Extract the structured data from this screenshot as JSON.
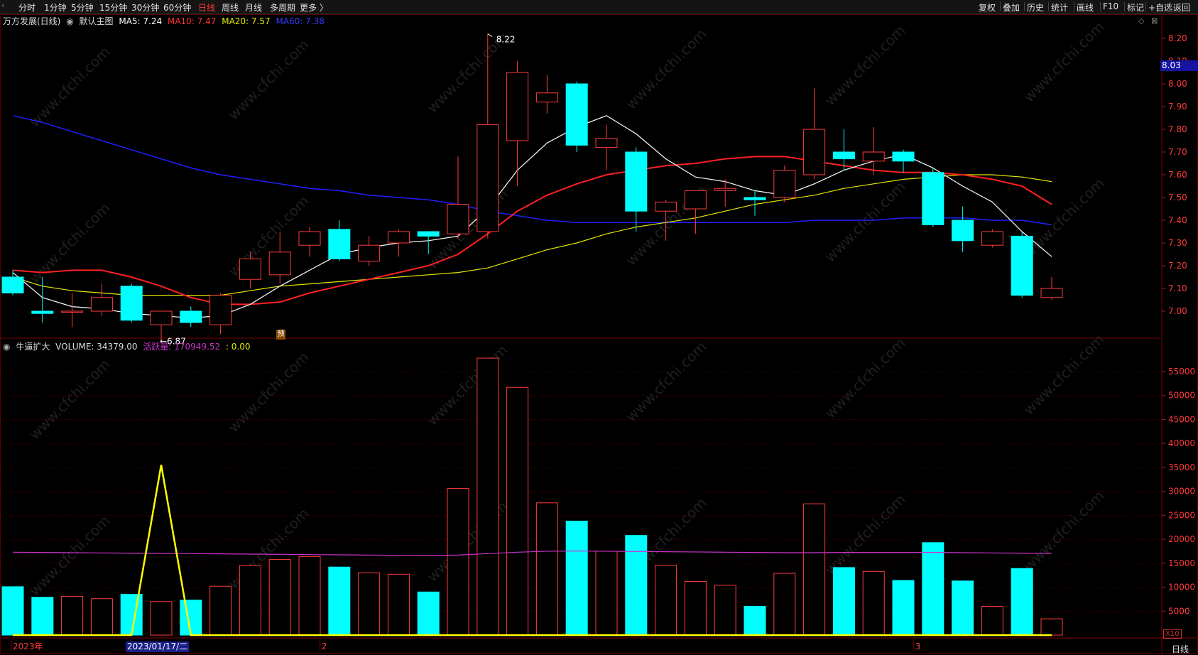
{
  "toolbar": {
    "left_tabs": [
      "分时",
      "1分钟",
      "5分钟",
      "15分钟",
      "30分钟",
      "60分钟",
      "日线",
      "周线",
      "月线",
      "多周期",
      "更多 〉"
    ],
    "active_tab": "日线",
    "right_tabs": [
      "复权",
      "叠加",
      "历史",
      "统计",
      "画线",
      "F10",
      "标记",
      "+自选",
      "返回"
    ]
  },
  "main_header": {
    "stock": "万方发展(日线)",
    "template": "默认主图",
    "ma5": "MA5: 7.24",
    "ma10": "MA10: 7.47",
    "ma20": "MA20: 7.57",
    "ma60": "MA60: 7.38"
  },
  "vol_header": {
    "indicator": "牛逼扩大",
    "volume": "VOLUME: 34379.00",
    "active": "活跃量: 170949.52",
    "extra": ": 0.00"
  },
  "colors": {
    "up": "#ff3b3b",
    "down": "#00ffff",
    "ma5": "#ffffff",
    "ma10": "#ff2020",
    "ma20": "#e6e600",
    "ma60": "#2020ff",
    "active_line": "#cc33cc",
    "signal_line": "#ffff00",
    "grid": "#5a0000"
  },
  "annotations": {
    "high": "8.22",
    "low": "6.87",
    "yu": "预",
    "last_price": "8.03",
    "selected_date": "2023/01/17/二",
    "x10": "X10",
    "period": "日线"
  },
  "chart_data": {
    "type": "candlestick",
    "price_ylim": [
      6.9,
      8.25
    ],
    "price_ticks": [
      "8.20",
      "8.10",
      "8.00",
      "7.90",
      "7.80",
      "7.70",
      "7.60",
      "7.50",
      "7.40",
      "7.30",
      "7.20",
      "7.10",
      "7.00"
    ],
    "volume_ylim": [
      0,
      59000
    ],
    "volume_ticks": [
      "55000",
      "50000",
      "45000",
      "40000",
      "35000",
      "30000",
      "25000",
      "20000",
      "15000",
      "10000",
      "5000"
    ],
    "x_labels": [
      {
        "index": 0,
        "label": "2023年"
      },
      {
        "index": 10.4,
        "label": "2"
      },
      {
        "index": 30.4,
        "label": "3"
      }
    ],
    "candles": [
      {
        "o": 7.15,
        "h": 7.18,
        "l": 7.07,
        "c": 7.08,
        "v": 10100
      },
      {
        "o": 7.0,
        "h": 7.15,
        "l": 6.95,
        "c": 6.99,
        "v": 7900
      },
      {
        "o": 7.0,
        "h": 7.08,
        "l": 6.93,
        "c": 7.0,
        "v": 8100
      },
      {
        "o": 7.0,
        "h": 7.12,
        "l": 6.98,
        "c": 7.06,
        "v": 7600
      },
      {
        "o": 7.11,
        "h": 7.12,
        "l": 6.95,
        "c": 6.96,
        "v": 8500
      },
      {
        "o": 6.94,
        "h": 7.0,
        "l": 6.87,
        "c": 7.0,
        "v": 7000
      },
      {
        "o": 7.0,
        "h": 7.02,
        "l": 6.93,
        "c": 6.95,
        "v": 7300
      },
      {
        "o": 6.94,
        "h": 7.08,
        "l": 6.9,
        "c": 7.07,
        "v": 10200
      },
      {
        "o": 7.14,
        "h": 7.26,
        "l": 7.1,
        "c": 7.23,
        "v": 14500
      },
      {
        "o": 7.16,
        "h": 7.35,
        "l": 7.12,
        "c": 7.26,
        "v": 15800
      },
      {
        "o": 7.29,
        "h": 7.37,
        "l": 7.24,
        "c": 7.35,
        "v": 16400
      },
      {
        "o": 7.36,
        "h": 7.4,
        "l": 7.22,
        "c": 7.23,
        "v": 14200
      },
      {
        "o": 7.22,
        "h": 7.33,
        "l": 7.2,
        "c": 7.29,
        "v": 13000
      },
      {
        "o": 7.3,
        "h": 7.36,
        "l": 7.24,
        "c": 7.35,
        "v": 12700
      },
      {
        "o": 7.35,
        "h": 7.35,
        "l": 7.25,
        "c": 7.33,
        "v": 9000
      },
      {
        "o": 7.34,
        "h": 7.68,
        "l": 7.32,
        "c": 7.47,
        "v": 30600
      },
      {
        "o": 7.35,
        "h": 8.22,
        "l": 7.32,
        "c": 7.82,
        "v": 57800
      },
      {
        "o": 7.75,
        "h": 8.1,
        "l": 7.55,
        "c": 8.05,
        "v": 51700
      },
      {
        "o": 7.92,
        "h": 8.04,
        "l": 7.87,
        "c": 7.96,
        "v": 27600
      },
      {
        "o": 8.0,
        "h": 8.01,
        "l": 7.7,
        "c": 7.73,
        "v": 23800
      },
      {
        "o": 7.72,
        "h": 7.82,
        "l": 7.62,
        "c": 7.76,
        "v": 17500
      },
      {
        "o": 7.7,
        "h": 7.72,
        "l": 7.35,
        "c": 7.44,
        "v": 20800
      },
      {
        "o": 7.44,
        "h": 7.49,
        "l": 7.31,
        "c": 7.48,
        "v": 14600
      },
      {
        "o": 7.45,
        "h": 7.53,
        "l": 7.34,
        "c": 7.53,
        "v": 11200
      },
      {
        "o": 7.53,
        "h": 7.58,
        "l": 7.46,
        "c": 7.54,
        "v": 10400
      },
      {
        "o": 7.5,
        "h": 7.53,
        "l": 7.42,
        "c": 7.49,
        "v": 6000
      },
      {
        "o": 7.5,
        "h": 7.64,
        "l": 7.48,
        "c": 7.62,
        "v": 12900
      },
      {
        "o": 7.6,
        "h": 7.98,
        "l": 7.58,
        "c": 7.8,
        "v": 27400
      },
      {
        "o": 7.7,
        "h": 7.8,
        "l": 7.62,
        "c": 7.67,
        "v": 14100
      },
      {
        "o": 7.66,
        "h": 7.81,
        "l": 7.6,
        "c": 7.7,
        "v": 13300
      },
      {
        "o": 7.7,
        "h": 7.71,
        "l": 7.61,
        "c": 7.66,
        "v": 11400
      },
      {
        "o": 7.61,
        "h": 7.63,
        "l": 7.37,
        "c": 7.38,
        "v": 19300
      },
      {
        "o": 7.4,
        "h": 7.46,
        "l": 7.26,
        "c": 7.31,
        "v": 11300
      },
      {
        "o": 7.29,
        "h": 7.36,
        "l": 7.28,
        "c": 7.35,
        "v": 6000
      },
      {
        "o": 7.33,
        "h": 7.35,
        "l": 7.06,
        "c": 7.07,
        "v": 13900
      },
      {
        "o": 7.06,
        "h": 7.15,
        "l": 7.05,
        "c": 7.1,
        "v": 3400
      }
    ],
    "ma5": [
      7.17,
      7.06,
      7.02,
      7.01,
      6.99,
      6.98,
      6.97,
      6.98,
      7.03,
      7.11,
      7.18,
      7.25,
      7.28,
      7.3,
      7.31,
      7.33,
      7.45,
      7.62,
      7.74,
      7.81,
      7.86,
      7.78,
      7.67,
      7.59,
      7.57,
      7.53,
      7.51,
      7.56,
      7.62,
      7.66,
      7.69,
      7.63,
      7.55,
      7.48,
      7.35,
      7.24
    ],
    "ma10": [
      7.18,
      7.17,
      7.18,
      7.18,
      7.15,
      7.11,
      7.06,
      7.03,
      7.03,
      7.04,
      7.08,
      7.11,
      7.14,
      7.17,
      7.2,
      7.25,
      7.34,
      7.44,
      7.51,
      7.56,
      7.6,
      7.62,
      7.64,
      7.65,
      7.67,
      7.68,
      7.68,
      7.66,
      7.64,
      7.62,
      7.61,
      7.61,
      7.6,
      7.58,
      7.55,
      7.47
    ],
    "ma20": [
      7.15,
      7.11,
      7.09,
      7.08,
      7.07,
      7.07,
      7.07,
      7.07,
      7.09,
      7.11,
      7.12,
      7.13,
      7.14,
      7.15,
      7.16,
      7.17,
      7.19,
      7.23,
      7.27,
      7.3,
      7.34,
      7.37,
      7.39,
      7.41,
      7.44,
      7.47,
      7.49,
      7.51,
      7.54,
      7.56,
      7.58,
      7.59,
      7.6,
      7.6,
      7.59,
      7.57
    ],
    "ma60": [
      7.86,
      7.83,
      7.79,
      7.75,
      7.71,
      7.67,
      7.63,
      7.6,
      7.58,
      7.56,
      7.54,
      7.53,
      7.51,
      7.5,
      7.49,
      7.47,
      7.44,
      7.42,
      7.4,
      7.39,
      7.39,
      7.39,
      7.39,
      7.39,
      7.39,
      7.39,
      7.39,
      7.4,
      7.4,
      7.4,
      7.41,
      7.41,
      7.41,
      7.4,
      7.4,
      7.38
    ],
    "active_line": [
      17300,
      17250,
      17200,
      17150,
      17100,
      17050,
      17000,
      16950,
      16900,
      16850,
      16800,
      16750,
      16700,
      16650,
      16600,
      16700,
      17000,
      17300,
      17500,
      17550,
      17500,
      17450,
      17400,
      17350,
      17300,
      17250,
      17200,
      17200,
      17250,
      17250,
      17250,
      17250,
      17200,
      17150,
      17100,
      17050
    ],
    "signal_line": [
      0,
      0,
      0,
      0,
      0,
      35500,
      0,
      0,
      0,
      0,
      0,
      0,
      0,
      0,
      0,
      0,
      0,
      0,
      0,
      0,
      0,
      0,
      0,
      0,
      0,
      0,
      0,
      0,
      0,
      0,
      0,
      0,
      0,
      0,
      0,
      0
    ]
  }
}
